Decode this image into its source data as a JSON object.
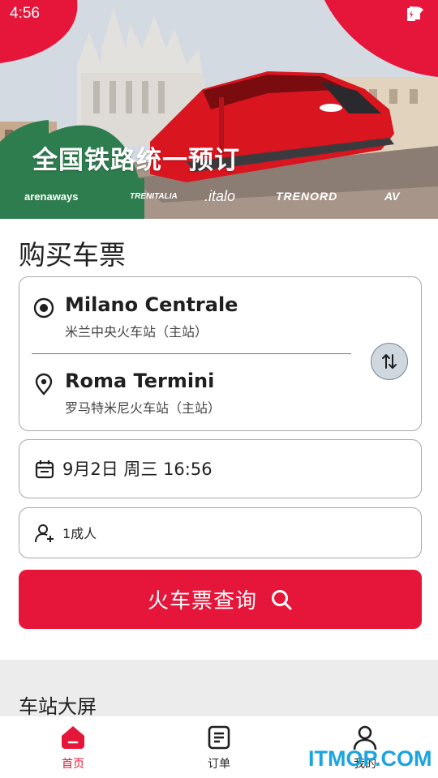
{
  "status_bar": {
    "time": "4:56"
  },
  "hero": {
    "title": "全国铁路统一预订",
    "brands": [
      "arenaways",
      "TRENITALIA",
      ".italo",
      "TRENORD",
      "AV"
    ]
  },
  "booking": {
    "section_title": "购买车票",
    "from": {
      "name": "Milano Centrale",
      "sub": "米兰中央火车站（主站）"
    },
    "to": {
      "name": "Roma Termini",
      "sub": "罗马特米尼火车站（主站）"
    },
    "date": "9月2日 周三 16:56",
    "passengers": "1成人",
    "search_label": "火车票查询"
  },
  "board": {
    "title": "车站大屏"
  },
  "bottom_nav": {
    "items": [
      {
        "label": "首页"
      },
      {
        "label": "订单"
      },
      {
        "label": "我的"
      }
    ]
  },
  "watermark": "ITMOP.COM",
  "colors": {
    "accent": "#e5163a",
    "hero_green": "#2e7d4f",
    "watermark": "#1aa4e0"
  }
}
